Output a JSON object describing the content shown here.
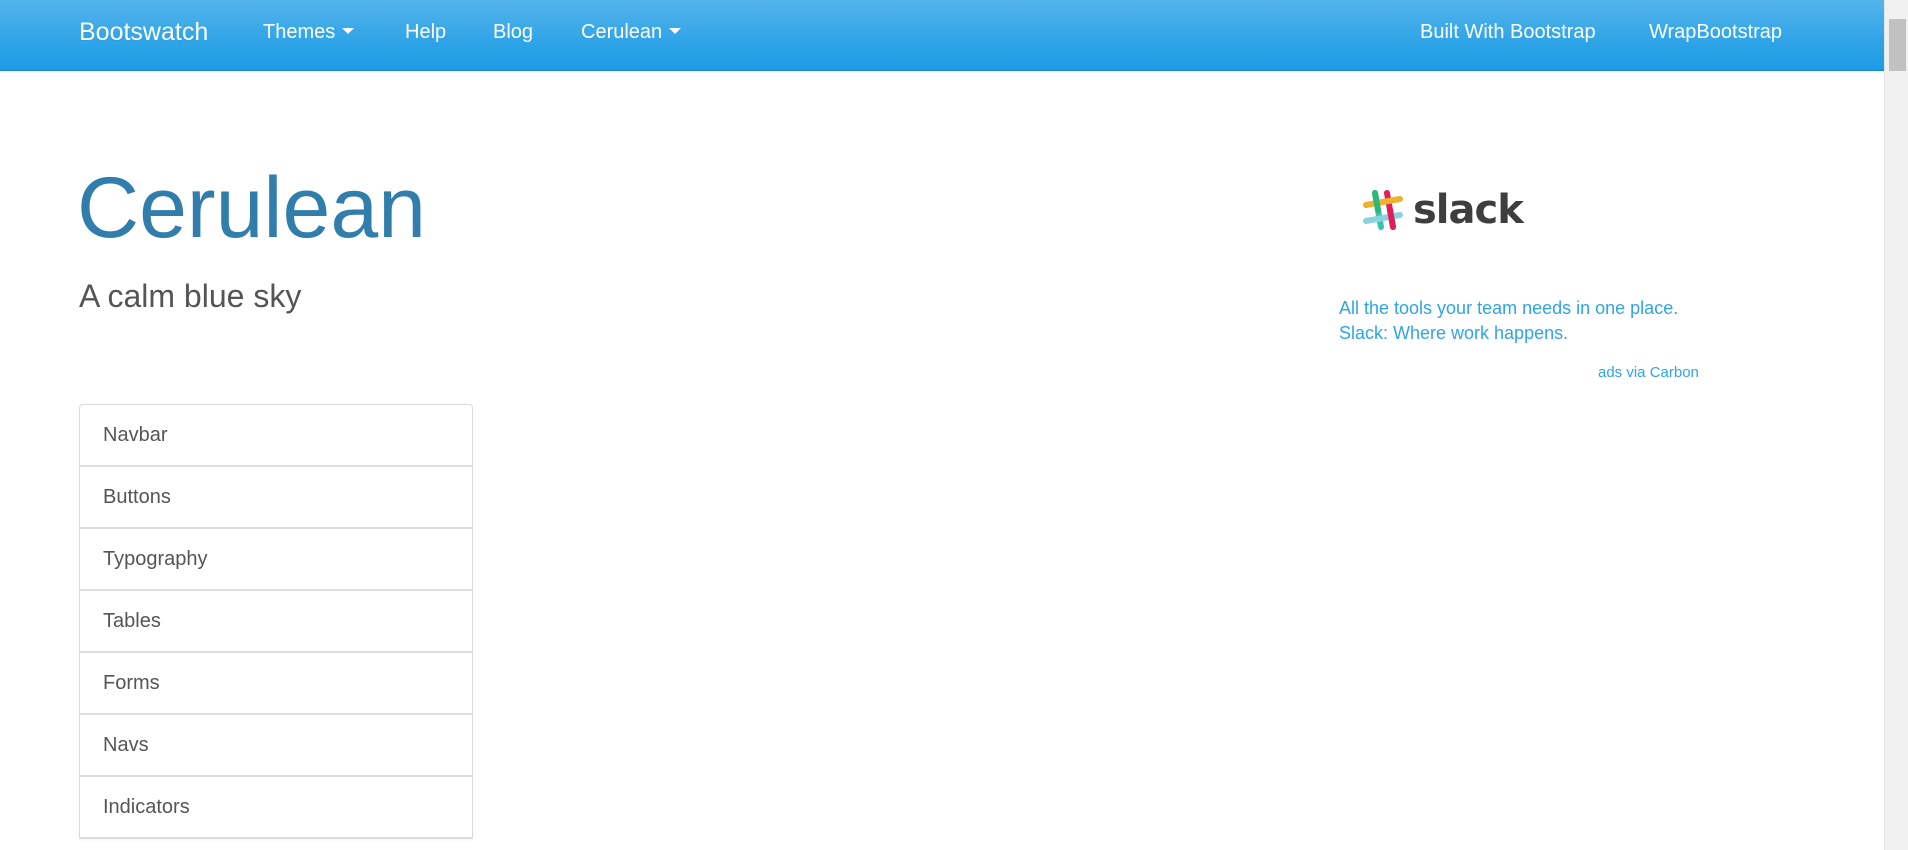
{
  "navbar": {
    "brand": "Bootswatch",
    "left_links": [
      {
        "label": "Themes",
        "dropdown": true
      },
      {
        "label": "Help",
        "dropdown": false
      },
      {
        "label": "Blog",
        "dropdown": false
      },
      {
        "label": "Cerulean",
        "dropdown": true
      }
    ],
    "right_links": [
      {
        "label": "Built With Bootstrap"
      },
      {
        "label": "WrapBootstrap"
      }
    ]
  },
  "header": {
    "title": "Cerulean",
    "lead": "A calm blue sky"
  },
  "sections": {
    "items": [
      {
        "label": "Navbar"
      },
      {
        "label": "Buttons"
      },
      {
        "label": "Typography"
      },
      {
        "label": "Tables"
      },
      {
        "label": "Forms"
      },
      {
        "label": "Navs"
      },
      {
        "label": "Indicators"
      }
    ]
  },
  "ad": {
    "logo_text": "slack",
    "line1": "All the tools your team needs in one place.",
    "line2": "Slack: Where work happens.",
    "via": "ads via Carbon",
    "logo_icon": "slack-hash-icon"
  },
  "colors": {
    "navbar": "#2fa4e7",
    "title": "#317eac",
    "link": "#2fa4e7",
    "text": "#555555"
  }
}
